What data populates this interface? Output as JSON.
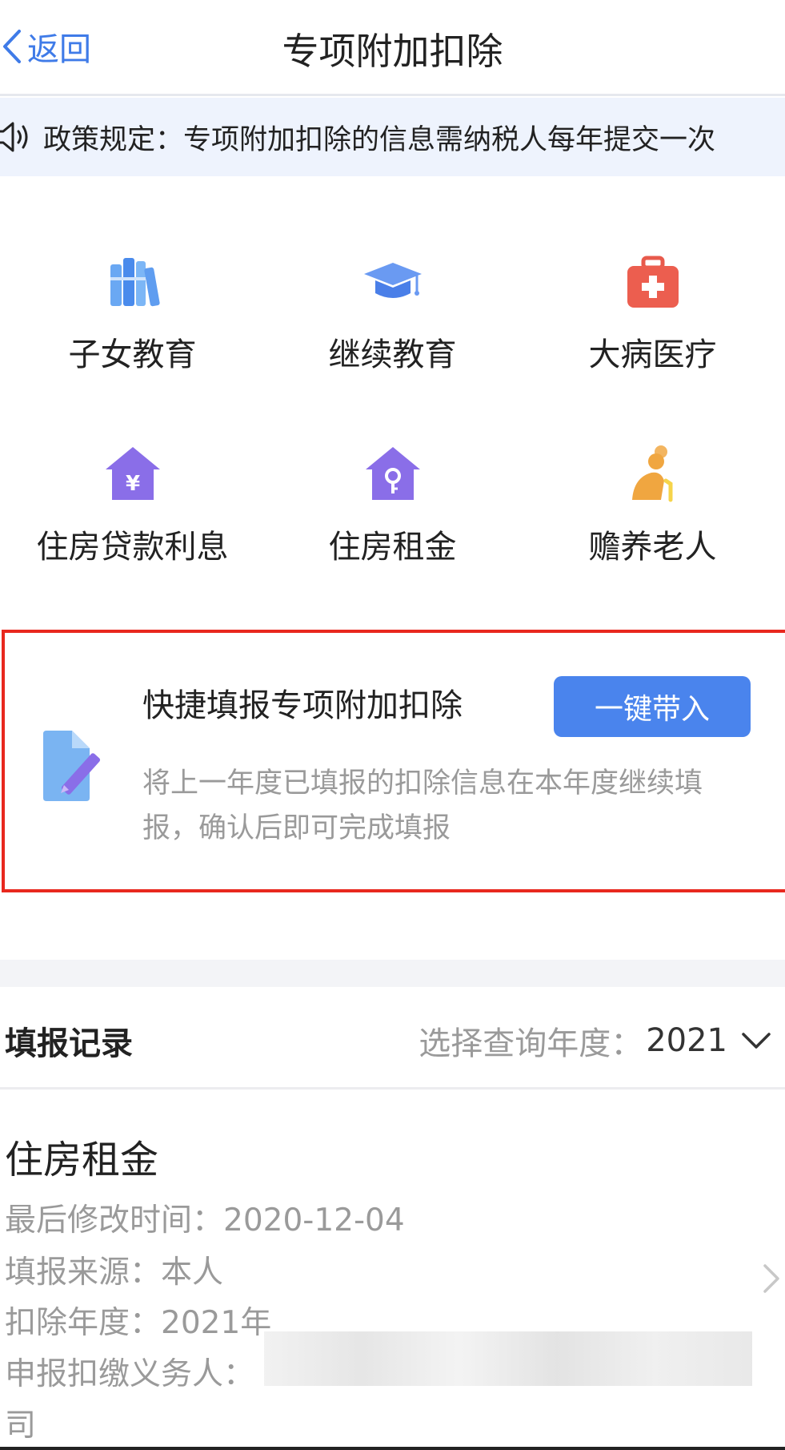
{
  "nav": {
    "back_label": "返回",
    "title": "专项附加扣除"
  },
  "notice": {
    "icon": "speaker-icon",
    "text": "政策规定：专项附加扣除的信息需纳税人每年提交一次"
  },
  "categories": [
    {
      "label": "子女教育",
      "icon": "books-icon",
      "color": "#5b9df0"
    },
    {
      "label": "继续教育",
      "icon": "graduation-cap-icon",
      "color": "#5b8ef0"
    },
    {
      "label": "大病医疗",
      "icon": "medical-kit-icon",
      "color": "#e85a4c"
    },
    {
      "label": "住房贷款利息",
      "icon": "house-yen-icon",
      "color": "#8a6ee8"
    },
    {
      "label": "住房租金",
      "icon": "house-key-icon",
      "color": "#8a6ee8"
    },
    {
      "label": "赡养老人",
      "icon": "elderly-icon",
      "color": "#f0a640"
    }
  ],
  "quick": {
    "title": "快捷填报专项附加扣除",
    "button": "一键带入",
    "desc": "将上一年度已填报的扣除信息在本年度继续填报，确认后即可完成填报",
    "icon": "document-edit-icon"
  },
  "records": {
    "title": "填报记录",
    "year_label": "选择查询年度：",
    "year_value": "2021",
    "item": {
      "name": "住房租金",
      "modified_label": "最后修改时间：",
      "modified_value": "2020-12-04",
      "source_label": "填报来源：",
      "source_value": "本人",
      "year_label": "扣除年度：",
      "year_value": "2021年",
      "agent_label": "申报扣缴义务人：",
      "agent_tail": "司"
    }
  },
  "colors": {
    "accent": "#4a84ed",
    "highlight_border": "#e8281e",
    "notice_bg": "#eef3fd"
  }
}
